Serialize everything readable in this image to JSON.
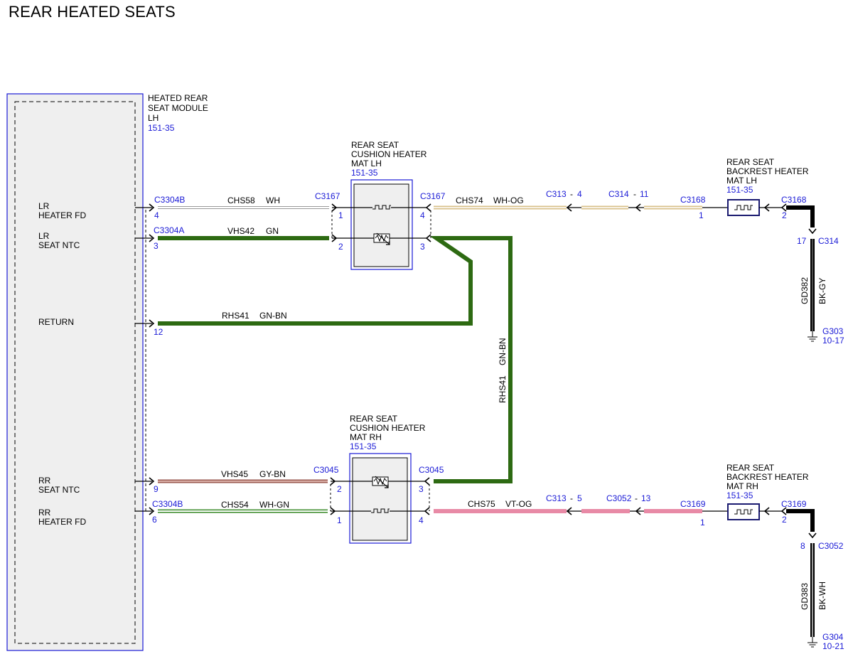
{
  "title": "REAR HEATED SEATS",
  "colors": {
    "blue": "#1a1ad6",
    "green": "#2d6a12",
    "pink": "#e88aa6",
    "tan": "#d8c08a",
    "black": "#000000",
    "gray_fill": "#efefef"
  },
  "module": {
    "name": [
      "HEATED REAR",
      "SEAT MODULE",
      "LH"
    ],
    "ref": "151-35",
    "pins": [
      "LR",
      "HEATER FD",
      "LR",
      "SEAT NTC",
      "RETURN",
      "RR",
      "SEAT NTC",
      "RR",
      "HEATER FD"
    ]
  },
  "cushion_lh": {
    "name": [
      "REAR SEAT",
      "CUSHION HEATER",
      "MAT LH"
    ],
    "ref": "151-35",
    "symbols": [
      "heater-element-icon",
      "thermistor-icon"
    ]
  },
  "cushion_rh": {
    "name": [
      "REAR SEAT",
      "CUSHION HEATER",
      "MAT RH"
    ],
    "ref": "151-35",
    "symbols": [
      "thermistor-icon",
      "heater-element-icon"
    ]
  },
  "backrest_lh": {
    "name": [
      "REAR SEAT",
      "BACKREST HEATER",
      "MAT LH"
    ],
    "ref": "151-35",
    "symbol": "heater-element-icon"
  },
  "backrest_rh": {
    "name": [
      "REAR SEAT",
      "BACKREST HEATER",
      "MAT RH"
    ],
    "ref": "151-35",
    "symbol": "heater-element-icon"
  },
  "connectors": {
    "c3304b_top": "C3304B",
    "c3304a": "C3304A",
    "c3304b_bottom": "C3304B",
    "c3167_left": "C3167",
    "c3167_right": "C3167",
    "c3045_left": "C3045",
    "c3045_right": "C3045",
    "c313_4": "C313",
    "c314_11": "C314",
    "c3168_left": "C3168",
    "c3168_right": "C3168",
    "c314_17": "C314",
    "c313_5": "C313",
    "c3052_13": "C3052",
    "c3169_left": "C3169",
    "c3169_right": "C3169",
    "c3052_8": "C3052"
  },
  "pin_numbers": {
    "p4a": "4",
    "p3a": "3",
    "p12": "12",
    "p9": "9",
    "p6": "6",
    "c3167_1": "1",
    "c3167_2": "2",
    "c3167_4": "4",
    "c3167_3": "3",
    "c3045_2": "2",
    "c3045_1": "1",
    "c3045_3": "3",
    "c3045_4": "4",
    "c313_4": "4",
    "c314_11": "11",
    "c3168_1": "1",
    "c3168_2": "2",
    "c314_17": "17",
    "c313_5": "5",
    "c3052_13": "13",
    "c3169_1": "1",
    "c3169_2": "2",
    "c3052_8": "8",
    "dash": "-"
  },
  "circuits": {
    "chs58": "CHS58",
    "chs58_color": "WH",
    "vhs42": "VHS42",
    "vhs42_color": "GN",
    "rhs41": "RHS41",
    "rhs41_color": "GN-BN",
    "rhs41_v": "RHS41",
    "rhs41_v_color": "GN-BN",
    "vhs45": "VHS45",
    "vhs45_color": "GY-BN",
    "chs54": "CHS54",
    "chs54_color": "WH-GN",
    "chs74": "CHS74",
    "chs74_color": "WH-OG",
    "chs75": "CHS75",
    "chs75_color": "VT-OG",
    "gd382": "GD382",
    "gd382_color": "BK-GY",
    "gd383": "GD383",
    "gd383_color": "BK-WH"
  },
  "grounds": {
    "g303": "G303",
    "g303_ref": "10-17",
    "g304": "G304",
    "g304_ref": "10-21"
  }
}
